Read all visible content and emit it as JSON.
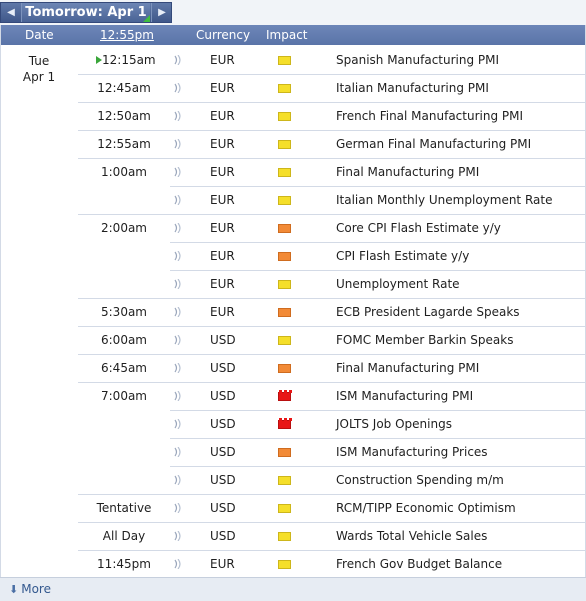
{
  "nav": {
    "prev_icon": "◀",
    "next_icon": "▶",
    "day_label": "Tomorrow: Apr 1"
  },
  "header": {
    "date": "Date",
    "time": "12:55pm",
    "currency": "Currency",
    "impact": "Impact"
  },
  "date_group": {
    "day": "Tue",
    "date": "Apr 1"
  },
  "impact_colors": {
    "low": "#f5df2a",
    "medium": "#f28a36",
    "high": "#e81616"
  },
  "events": [
    {
      "time": "12:15am",
      "currency": "EUR",
      "impact": "low",
      "title": "Spanish Manufacturing PMI",
      "current": true
    },
    {
      "time": "12:45am",
      "currency": "EUR",
      "impact": "low",
      "title": "Italian Manufacturing PMI"
    },
    {
      "time": "12:50am",
      "currency": "EUR",
      "impact": "low",
      "title": "French Final Manufacturing PMI"
    },
    {
      "time": "12:55am",
      "currency": "EUR",
      "impact": "low",
      "title": "German Final Manufacturing PMI"
    },
    {
      "time": "1:00am",
      "currency": "EUR",
      "impact": "low",
      "title": "Final Manufacturing PMI"
    },
    {
      "time": "",
      "currency": "EUR",
      "impact": "low",
      "title": "Italian Monthly Unemployment Rate"
    },
    {
      "time": "2:00am",
      "currency": "EUR",
      "impact": "medium",
      "title": "Core CPI Flash Estimate y/y"
    },
    {
      "time": "",
      "currency": "EUR",
      "impact": "medium",
      "title": "CPI Flash Estimate y/y"
    },
    {
      "time": "",
      "currency": "EUR",
      "impact": "low",
      "title": "Unemployment Rate"
    },
    {
      "time": "5:30am",
      "currency": "EUR",
      "impact": "medium",
      "title": "ECB President Lagarde Speaks"
    },
    {
      "time": "6:00am",
      "currency": "USD",
      "impact": "low",
      "title": "FOMC Member Barkin Speaks"
    },
    {
      "time": "6:45am",
      "currency": "USD",
      "impact": "medium",
      "title": "Final Manufacturing PMI"
    },
    {
      "time": "7:00am",
      "currency": "USD",
      "impact": "high",
      "title": "ISM Manufacturing PMI"
    },
    {
      "time": "",
      "currency": "USD",
      "impact": "high",
      "title": "JOLTS Job Openings"
    },
    {
      "time": "",
      "currency": "USD",
      "impact": "medium",
      "title": "ISM Manufacturing Prices"
    },
    {
      "time": "",
      "currency": "USD",
      "impact": "low",
      "title": "Construction Spending m/m"
    },
    {
      "time": "Tentative",
      "currency": "USD",
      "impact": "low",
      "title": "RCM/TIPP Economic Optimism"
    },
    {
      "time": "All Day",
      "currency": "USD",
      "impact": "low",
      "title": "Wards Total Vehicle Sales"
    },
    {
      "time": "11:45pm",
      "currency": "EUR",
      "impact": "low",
      "title": "French Gov Budget Balance"
    }
  ],
  "footer": {
    "more_label": "More",
    "more_icon": "download-arrow-icon"
  }
}
